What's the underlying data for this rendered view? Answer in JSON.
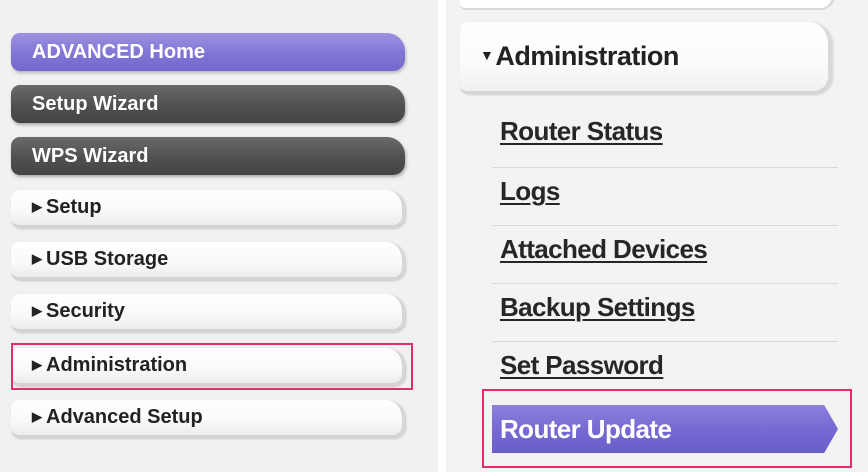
{
  "left_menu": {
    "items": [
      {
        "label": "ADVANCED Home"
      },
      {
        "label": "Setup Wizard"
      },
      {
        "label": "WPS Wizard"
      },
      {
        "label": "Setup"
      },
      {
        "label": "USB Storage"
      },
      {
        "label": "Security"
      },
      {
        "label": "Administration"
      },
      {
        "label": "Advanced Setup"
      }
    ]
  },
  "right_menu": {
    "header": {
      "label": "Administration"
    },
    "items": [
      {
        "label": "Router Status"
      },
      {
        "label": "Logs"
      },
      {
        "label": "Attached Devices"
      },
      {
        "label": "Backup Settings"
      },
      {
        "label": "Set Password"
      },
      {
        "label": "Router Update"
      }
    ]
  },
  "icons": {
    "collapsed": "triangle-right-icon",
    "expanded": "triangle-down-icon"
  },
  "colors": {
    "accent_purple": "#7f73d4",
    "dark_button": "#505050",
    "highlight": "#e0306a"
  }
}
